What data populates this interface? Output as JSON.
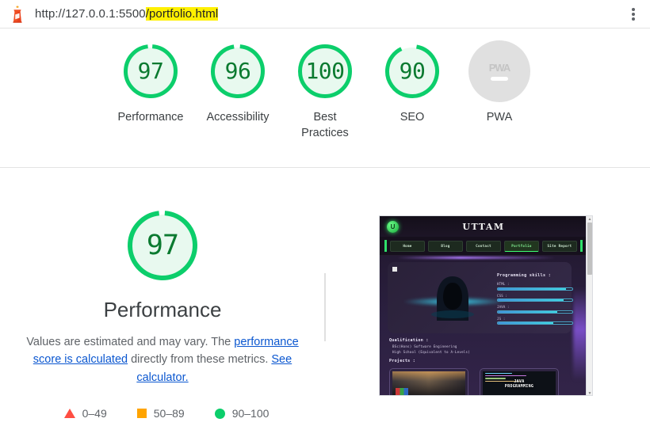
{
  "urlbar": {
    "icon": "lighthouse-icon",
    "url_prefix": "http://127.0.0.1:5500",
    "url_highlight": "/portfolio.html",
    "menu_icon": "more-vert-icon"
  },
  "scores": [
    {
      "label": "Performance",
      "value": "97",
      "arc": 97,
      "state": "pass"
    },
    {
      "label": "Accessibility",
      "value": "96",
      "arc": 96,
      "state": "pass"
    },
    {
      "label": "Best\nPractices",
      "label_l1": "Best",
      "label_l2": "Practices",
      "value": "100",
      "arc": 100,
      "state": "pass"
    },
    {
      "label": "SEO",
      "value": "90",
      "arc": 90,
      "state": "pass"
    },
    {
      "label": "PWA",
      "value": "PWA",
      "arc": 0,
      "state": "null",
      "dash": "—"
    }
  ],
  "category": {
    "gauge_value": "97",
    "gauge_arc": 97,
    "title": "Performance",
    "desc_part1": "Values are estimated and may vary. The ",
    "link1": "performance score is calculated",
    "desc_part2": " directly from these metrics. ",
    "link2": "See calculator.",
    "legend": [
      {
        "shape": "triangle",
        "range": "0–49",
        "color": "#ff4e42"
      },
      {
        "shape": "square",
        "range": "50–89",
        "color": "#ffa400"
      },
      {
        "shape": "circle",
        "range": "90–100",
        "color": "#0cce6b"
      }
    ]
  },
  "colors": {
    "pass": "#0cce6b",
    "pass_fill": "#e8f9ef",
    "pass_text": "#0b7a30",
    "average": "#ffa400",
    "fail": "#ff4e42",
    "null_gray": "#e0e0e0",
    "link": "#0b57d0",
    "highlight": "#fff000"
  },
  "thumbnail": {
    "site_title": "UTTAM",
    "logo": "u-logo-icon",
    "nav": [
      {
        "label": "Home",
        "active": false
      },
      {
        "label": "Blog",
        "active": false
      },
      {
        "label": "Contact",
        "active": false
      },
      {
        "label": "Portfolio",
        "active": true
      },
      {
        "label": "Site Report",
        "active": false
      }
    ],
    "hero_alt": "hooded-figure-image",
    "skills_heading": "Programming skills :",
    "skills": [
      {
        "name": "HTML :",
        "pct": 92
      },
      {
        "name": "CSS :",
        "pct": 88
      },
      {
        "name": "JAVA :",
        "pct": 80
      },
      {
        "name": "JS :",
        "pct": 74
      }
    ],
    "qualification_heading": "Qualification :",
    "qualification_lines": [
      "BSc(Hons) Software Engineering",
      "High School (Equivalent to A-Levels)"
    ],
    "projects_heading": "Projects :",
    "projects": [
      {
        "caption": ""
      },
      {
        "caption": "JAVA\nPROGRAMMING",
        "line1": "JAVA",
        "line2": "PROGRAMMING"
      }
    ],
    "scrollbar": {
      "up": "▲",
      "down": "▼"
    }
  }
}
